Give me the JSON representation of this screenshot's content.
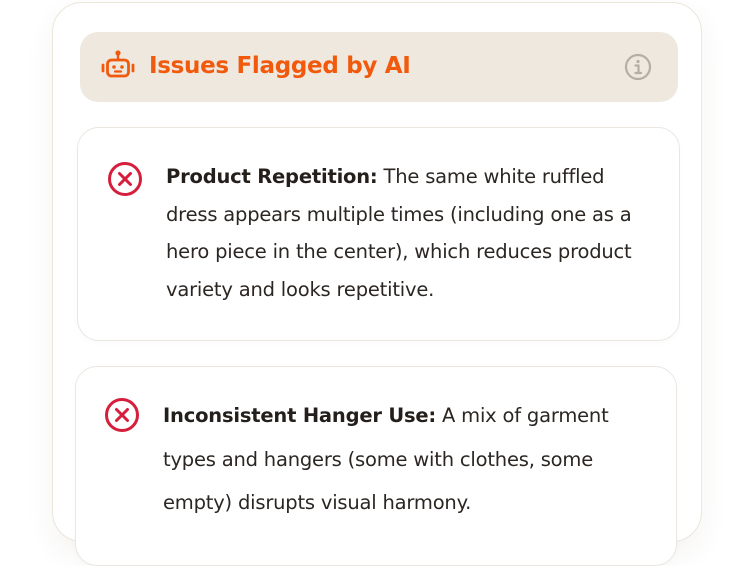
{
  "header": {
    "title": "Issues Flagged by AI",
    "accent_color": "#f15a0d",
    "icons": {
      "left": "robot-icon",
      "right": "info-icon"
    }
  },
  "issues": [
    {
      "title": "Product Repetition:",
      "description": "The same white ruffled dress appears multiple times (including one as a hero piece in the center), which reduces product variety and looks repetitive.",
      "status_icon": "error-x-icon",
      "status_color": "#d51f3c"
    },
    {
      "title": "Inconsistent Hanger Use:",
      "description": "A mix of garment types and hangers (some with clothes, some empty) disrupts visual harmony.",
      "status_icon": "error-x-icon",
      "status_color": "#d51f3c"
    }
  ]
}
